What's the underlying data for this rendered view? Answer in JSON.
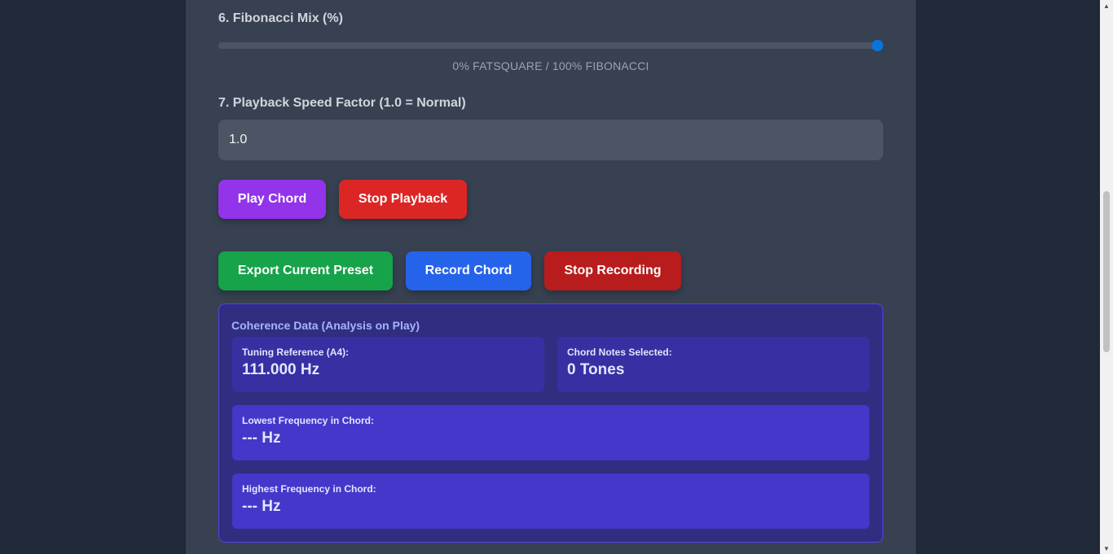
{
  "fibonacci": {
    "label": "6. Fibonacci Mix (%)",
    "value_percent": 100,
    "caption": "0% FATSQUARE / 100% FIBONACCI"
  },
  "speed": {
    "label": "7. Playback Speed Factor (1.0 = Normal)",
    "value": "1.0"
  },
  "buttons": {
    "play": "Play Chord",
    "stop_playback": "Stop Playback",
    "export": "Export Current Preset",
    "record": "Record Chord",
    "stop_recording": "Stop Recording"
  },
  "colors": {
    "play": "#9333ea",
    "stop_playback": "#dc2626",
    "export": "#16a34a",
    "record": "#2563eb",
    "stop_recording": "#b91c1c",
    "slider_thumb": "#0a74da"
  },
  "coherence": {
    "title": "Coherence Data (Analysis on Play)",
    "tuning": {
      "label": "Tuning Reference (A4):",
      "value": "111.000 Hz"
    },
    "notes": {
      "label": "Chord Notes Selected:",
      "value": "0 Tones"
    },
    "lowest": {
      "label": "Lowest Frequency in Chord:",
      "value": "--- Hz"
    },
    "highest": {
      "label": "Highest Frequency in Chord:",
      "value": "--- Hz"
    }
  },
  "icons": {
    "scroll_up": "triangle-up",
    "scroll_down": "triangle-down"
  }
}
